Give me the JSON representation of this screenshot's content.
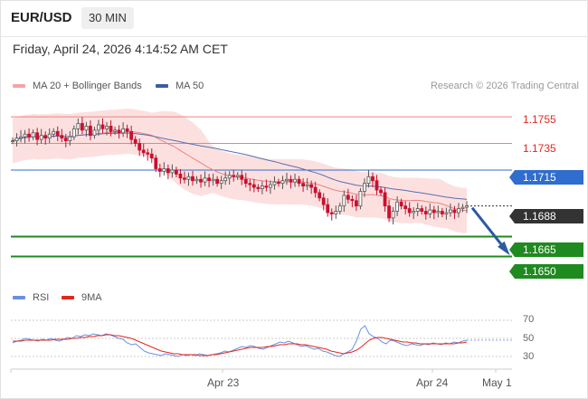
{
  "header": {
    "symbol": "EUR/USD",
    "timeframe": "30 MIN"
  },
  "timestamp": "Friday, April 24, 2026 4:14:52 AM CET",
  "legend": {
    "ma20": {
      "label": "MA 20 + Bollinger Bands",
      "color": "#f08080"
    },
    "ma50": {
      "label": "MA 50",
      "color": "#3b5ba5"
    }
  },
  "credit": "Research © 2026 Trading Central",
  "levels": {
    "r2": "1.1755",
    "r1": "1.1735",
    "pivot": "1.1715",
    "last": "1.1688",
    "s1": "1.1665",
    "s2": "1.1650"
  },
  "rsi_legend": {
    "rsi": "RSI",
    "ma9": "9MA"
  },
  "rsi_ticks": [
    "70",
    "50",
    "30"
  ],
  "x_labels": [
    "Apr 23",
    "Apr 24",
    "May 1"
  ],
  "chart_data": {
    "type": "candlestick",
    "y_range": [
      1.1632,
      1.1768
    ],
    "horizontal_levels": [
      {
        "value": 1.1755,
        "color": "#f08080",
        "label": "1.1755"
      },
      {
        "value": 1.1735,
        "color": "#f08080",
        "label": "1.1735"
      },
      {
        "value": 1.1715,
        "color": "#2f6dcf",
        "label": "1.1715"
      },
      {
        "value": 1.1688,
        "color": "#333333",
        "label": "1.1688",
        "style": "dotted"
      },
      {
        "value": 1.1665,
        "color": "#1f8a1f",
        "label": "1.1665"
      },
      {
        "value": 1.165,
        "color": "#1f8a1f",
        "label": "1.1650"
      }
    ],
    "close": [
      1.1737,
      1.1739,
      1.174,
      1.1742,
      1.174,
      1.1743,
      1.1738,
      1.1741,
      1.1739,
      1.1742,
      1.1744,
      1.1741,
      1.1739,
      1.1737,
      1.174,
      1.1746,
      1.175,
      1.1745,
      1.1748,
      1.1741,
      1.1745,
      1.1749,
      1.1746,
      1.1748,
      1.1744,
      1.1745,
      1.1743,
      1.1746,
      1.1744,
      1.1738,
      1.1735,
      1.173,
      1.1728,
      1.1727,
      1.1724,
      1.1716,
      1.1714,
      1.1716,
      1.1713,
      1.1715,
      1.1712,
      1.1709,
      1.1708,
      1.171,
      1.1707,
      1.1708,
      1.1706,
      1.1709,
      1.1707,
      1.1708,
      1.1705,
      1.1707,
      1.1709,
      1.1711,
      1.171,
      1.1711,
      1.1708,
      1.1705,
      1.1704,
      1.1702,
      1.1701,
      1.1703,
      1.1702,
      1.1704,
      1.1706,
      1.1705,
      1.1707,
      1.1708,
      1.1706,
      1.1708,
      1.1705,
      1.1703,
      1.1704,
      1.1702,
      1.1698,
      1.1694,
      1.1689,
      1.1683,
      1.1682,
      1.1684,
      1.1688,
      1.1696,
      1.1693,
      1.1692,
      1.1688,
      1.1699,
      1.1705,
      1.171,
      1.1707,
      1.17,
      1.1698,
      1.1688,
      1.1679,
      1.1684,
      1.1691,
      1.1688,
      1.1686,
      1.1683,
      1.1684,
      1.1686,
      1.1684,
      1.1682,
      1.1685,
      1.1683,
      1.1684,
      1.1682,
      1.1683,
      1.1685,
      1.1683,
      1.1686,
      1.1687,
      1.1688
    ],
    "projection": {
      "from": 1.1688,
      "to": 1.165
    },
    "rsi": [
      45,
      47,
      48,
      50,
      49,
      48,
      47,
      49,
      48,
      50,
      48,
      47,
      49,
      51,
      50,
      53,
      52,
      54,
      53,
      55,
      54,
      53,
      55,
      54,
      52,
      50,
      49,
      45,
      43,
      44,
      40,
      36,
      34,
      33,
      32,
      31,
      33,
      32,
      31,
      30,
      32,
      31,
      32,
      31,
      33,
      32,
      31,
      32,
      33,
      34,
      36,
      35,
      37,
      39,
      41,
      40,
      42,
      41,
      39,
      38,
      40,
      42,
      44,
      46,
      45,
      47,
      45,
      43,
      41,
      42,
      40,
      38,
      39,
      36,
      35,
      33,
      31,
      30,
      33,
      35,
      38,
      47,
      60,
      64,
      55,
      52,
      50,
      46,
      44,
      48,
      47,
      45,
      43,
      42,
      44,
      43,
      42,
      44,
      43,
      45,
      44,
      43,
      45,
      44,
      46,
      45,
      47,
      48
    ],
    "rsi_ma9": [
      47,
      47,
      47,
      48,
      48,
      48,
      48,
      48,
      48,
      48,
      49,
      49,
      49,
      49,
      50,
      50,
      51,
      51,
      52,
      52,
      53,
      53,
      54,
      54,
      53,
      53,
      52,
      51,
      50,
      48,
      46,
      44,
      42,
      40,
      38,
      36,
      35,
      34,
      33,
      33,
      32,
      32,
      32,
      32,
      31,
      31,
      31,
      32,
      32,
      33,
      34,
      35,
      36,
      37,
      38,
      39,
      40,
      40,
      40,
      40,
      41,
      41,
      42,
      43,
      43,
      44,
      44,
      44,
      43,
      43,
      42,
      41,
      40,
      39,
      38,
      36,
      35,
      34,
      33,
      34,
      35,
      37,
      40,
      44,
      48,
      50,
      51,
      51,
      50,
      49,
      48,
      47,
      46,
      46,
      45,
      45,
      44,
      44,
      44,
      44,
      44,
      44,
      44,
      44,
      44,
      45,
      45,
      46
    ],
    "rsi_levels": [
      70,
      50,
      30
    ],
    "x_labels": [
      "Apr 23",
      "Apr 24",
      "May 1"
    ]
  }
}
